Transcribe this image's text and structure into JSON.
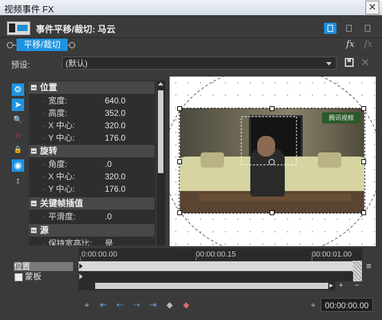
{
  "window": {
    "title": "视频事件 FX",
    "close": "✕"
  },
  "header": {
    "title": "事件平移/裁切: 马云"
  },
  "chain": {
    "plugin": "平移/裁切",
    "fx1": "fx",
    "fx2": "fx"
  },
  "preset": {
    "label": "预设:",
    "value": "(默认)"
  },
  "tools": {
    "settings": "⚙",
    "pointer": "➤",
    "zoom": "🔍",
    "magnet": "∩",
    "lock": "🔒",
    "target": "◉",
    "move": "↕"
  },
  "properties": {
    "sections": [
      {
        "name": "位置",
        "rows": [
          {
            "key": "宽度:",
            "value": "640.0"
          },
          {
            "key": "高度:",
            "value": "352.0"
          },
          {
            "key": "X 中心:",
            "value": "320.0"
          },
          {
            "key": "Y 中心:",
            "value": "176.0"
          }
        ]
      },
      {
        "name": "旋转",
        "rows": [
          {
            "key": "角度:",
            "value": ".0"
          },
          {
            "key": "X 中心:",
            "value": "320.0"
          },
          {
            "key": "Y 中心:",
            "value": "176.0"
          }
        ]
      },
      {
        "name": "关键帧插值",
        "rows": [
          {
            "key": "平滑度:",
            "value": ".0"
          }
        ]
      },
      {
        "name": "源",
        "rows": [
          {
            "key": "保持宽高比:",
            "value": "是"
          }
        ]
      }
    ]
  },
  "preview": {
    "tv_logo": "腾讯视频"
  },
  "timeline": {
    "timecodes": [
      "0:00:00.00",
      "00:00:00.15",
      "00:00:01.00"
    ],
    "tracks": [
      {
        "label": "位置",
        "selected": true
      },
      {
        "label": "蒙板",
        "checkbox": false
      }
    ],
    "current_time": "00:00:00.00",
    "plus": "+",
    "minus": "−",
    "menu": "≡"
  },
  "colors": {
    "accent": "#1f93e0",
    "bg": "#3a3a3a",
    "panel": "#2e2e2e"
  }
}
